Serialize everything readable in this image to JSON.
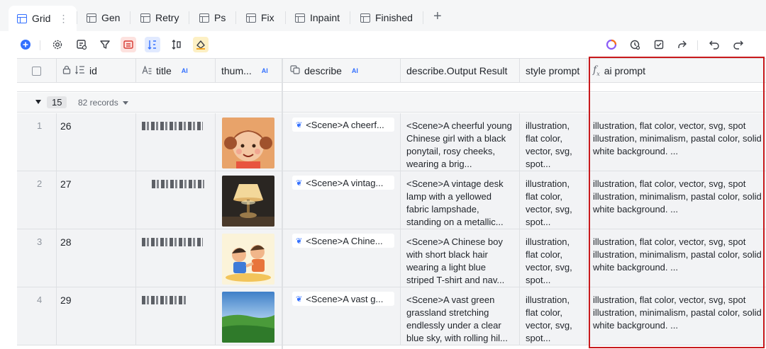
{
  "tabs": [
    {
      "label": "Grid",
      "active": true
    },
    {
      "label": "Gen"
    },
    {
      "label": "Retry"
    },
    {
      "label": "Ps"
    },
    {
      "label": "Fix"
    },
    {
      "label": "Inpaint"
    },
    {
      "label": "Finished"
    }
  ],
  "columns": {
    "id": "id",
    "title": "title",
    "thumb": "thum...",
    "describe": "describe",
    "output": "describe.Output Result",
    "style": "style prompt",
    "ai_prompt": "ai prompt",
    "ai_badge": "AI"
  },
  "group": {
    "value": "15",
    "records": "82 records"
  },
  "rows": [
    {
      "num": "1",
      "id": "26",
      "describe": "<Scene>A cheerf...",
      "output": "<Scene>A cheerful young Chinese girl with a black ponytail, rosy cheeks, wearing a brig...",
      "style": "illustration, flat color, vector, svg, spot...",
      "ai": "illustration, flat color, vector, svg, spot illustration, minimalism, pastal color, solid white background. ..."
    },
    {
      "num": "2",
      "id": "27",
      "describe": "<Scene>A vintag...",
      "output": "<Scene>A vintage desk lamp with a yellowed fabric lampshade, standing on a metallic...",
      "style": "illustration, flat color, vector, svg, spot...",
      "ai": "illustration, flat color, vector, svg, spot illustration, minimalism, pastal color, solid white background. ..."
    },
    {
      "num": "3",
      "id": "28",
      "describe": "<Scene>A Chine...",
      "output": "<Scene>A Chinese boy with short black hair wearing a light blue striped T-shirt and nav...",
      "style": "illustration, flat color, vector, svg, spot...",
      "ai": "illustration, flat color, vector, svg, spot illustration, minimalism, pastal color, solid white background. ..."
    },
    {
      "num": "4",
      "id": "29",
      "describe": "<Scene>A vast g...",
      "output": "<Scene>A vast green grassland stretching endlessly under a clear blue sky, with rolling hil...",
      "style": "illustration, flat color, vector, svg, spot...",
      "ai": "illustration, flat color, vector, svg, spot illustration, minimalism, pastal color, solid white background. ..."
    }
  ],
  "colors": {
    "accent": "#3370ff",
    "highlight": "#c8191c",
    "row_bg": "#f2f3f5"
  }
}
